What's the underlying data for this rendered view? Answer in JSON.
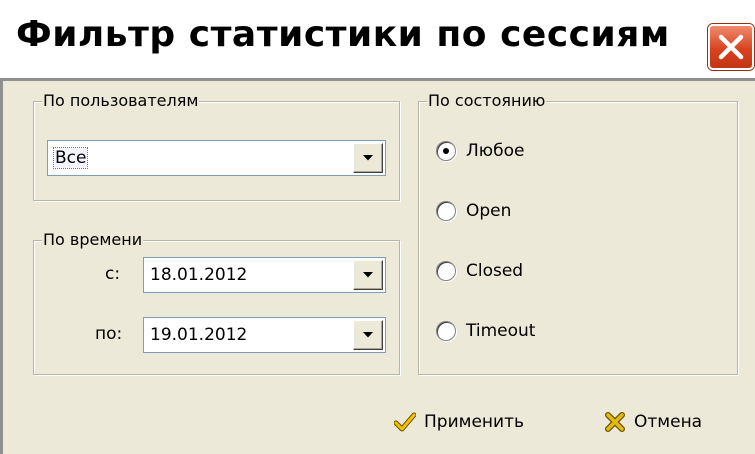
{
  "window": {
    "title": "Фильтр статистики по сессиям",
    "close_icon": "close-icon"
  },
  "users_group": {
    "legend": "По пользователям",
    "selected_value": "Все"
  },
  "time_group": {
    "legend": "По времени",
    "from_label": "с:",
    "from_value": "18.01.2012",
    "to_label": "по:",
    "to_value": "19.01.2012"
  },
  "state_group": {
    "legend": "По состоянию",
    "options": [
      {
        "label": "Любое",
        "checked": true
      },
      {
        "label": "Open",
        "checked": false
      },
      {
        "label": "Closed",
        "checked": false
      },
      {
        "label": "Timeout",
        "checked": false
      }
    ]
  },
  "actions": {
    "apply_label": "Применить",
    "apply_icon": "checkmark-icon",
    "cancel_label": "Отмена",
    "cancel_icon": "cross-icon"
  },
  "colors": {
    "dialog_bg": "#ece9d8",
    "close_red": "#d9431f",
    "field_border": "#7f9db9",
    "apply_check": "#d2a400",
    "cancel_cross": "#c8a000"
  }
}
